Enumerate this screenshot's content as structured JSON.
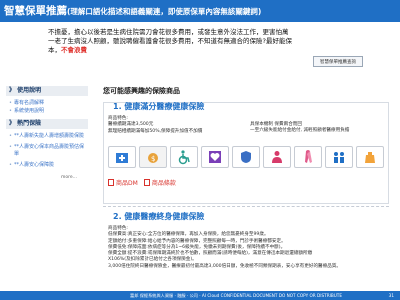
{
  "banner": {
    "title": "智慧保單推薦",
    "subtitle": "(理解口語化描述和語義關連，即使原保單內容無該關鍵詞)"
  },
  "query": {
    "text": "不擔憂，擔心以後若是生病住院需刀會花很多費用，或發生意外沒法工作，更害怕萬一老了生病沒人照顧，聽說聘僱看護會花很多費用，不知道有無適合的保險?最好能保本，",
    "highlight": "不會浪費",
    "search_button": "智慧保單推薦查詢"
  },
  "sidebar": {
    "section1": "使用說明",
    "items1": [
      "專有名詞解釋",
      "系統使用說明"
    ],
    "section2": "熱門保險",
    "items2": [
      "**人壽新失能人壽增額壽險保險",
      "**人壽安心保本商品壽險預估保單",
      "**人壽安心保障險"
    ],
    "more": "more..."
  },
  "main": {
    "title": "您可能感興趣的保險商品",
    "product1": {
      "name": "1. 健康滿分醫療健康保險",
      "features_label": "商品特色:",
      "feature1": "醫療續期滿達3,500元",
      "feature2": "無理賠相續期滿每加50%,保障提升加值不加價",
      "feature_right1": "具保本機制 保費兩合而回",
      "feature_right2": "一至六級失能給付金給付, 減輕照顧者醫療用負擔",
      "icons": [
        "hospital-icon",
        "money-bag-icon",
        "wheelchair-icon",
        "heart-icon",
        "shield-icon",
        "doctor-icon",
        "ribbon-icon",
        "family-icon",
        "kettle-icon"
      ],
      "dm_label": "商品DM",
      "terms_label": "商品條款"
    },
    "product2": {
      "name": "2. 健康醫療終身健康保險",
      "features_label": "商品特色:",
      "lines": [
        "低保費高:真正安心:全方位的醫療保障，再加入身保險，給您無憂終身至99歲。",
        "定額給付:多重保障:給心給予內容的醫療保障，完整照顧每一時，門診手術醫療都安定。",
        "保費低免:保障成面:依病症等分為1~6級失能，免繳未到期保費(後，保障持續不中斷)。",
        "保費全額:提不浪費:或保障期滿終於也不怕數，照顧而滿(請時便每給)，滿意在傳迅本期退還總額所繳",
        "X106%(及扣除累計已給付之各項保險金)。",
        "3,000倍住院終日醫療保險金，醫療最初付最高達3,000倍日額，免收極不同類保期表，安心享有更好的醫療品質。"
      ]
    }
  },
  "footer": {
    "text": "富邦 保經系統與人資服 · 融服 · 公司 · AI Cloud CONFIDENTIAL DOCUMENT DO NOT COPY OR DISTRIBUTE",
    "page": "31"
  },
  "colors": {
    "accent": "#1f6fc5",
    "highlight": "#e0342f"
  }
}
